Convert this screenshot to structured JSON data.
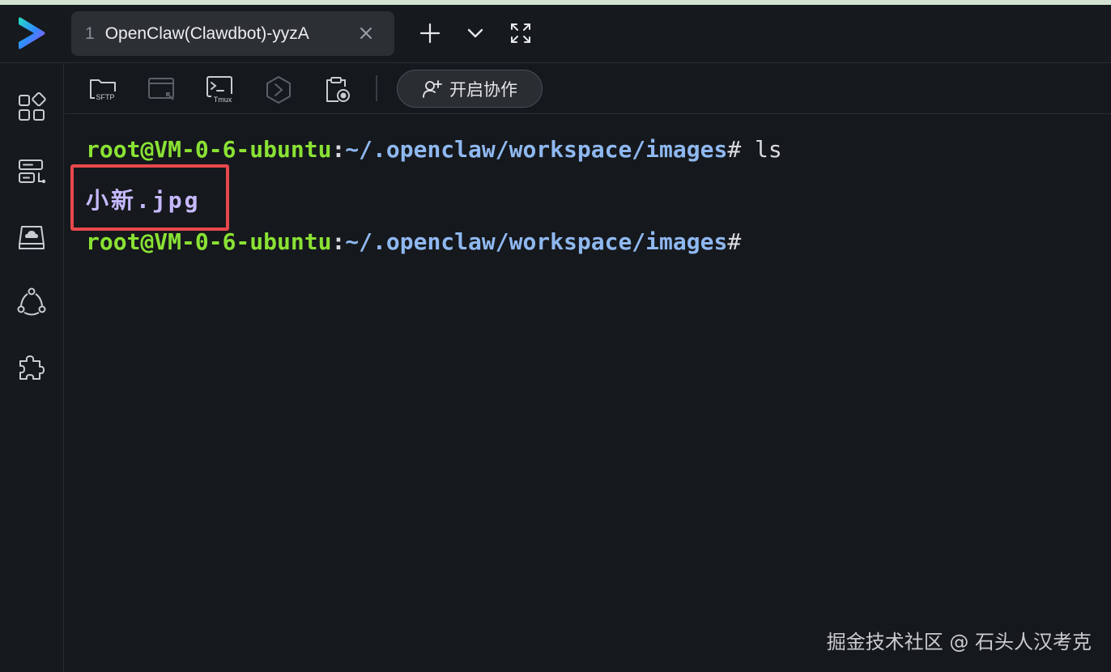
{
  "tab": {
    "number": "1",
    "title": "OpenClaw(Clawdbot)-yyzA"
  },
  "toolbar": {
    "sftp_label": "SFTP",
    "tmux_label": "Tmux",
    "collab_label": "开启协作"
  },
  "terminal": {
    "line1": {
      "user": "root@VM-0-6-ubuntu",
      "sep": ":",
      "path": "~/.openclaw/workspace/images",
      "prompt": "#",
      "command": " ls"
    },
    "line2": {
      "filename": "小新.jpg"
    },
    "line3": {
      "user": "root@VM-0-6-ubuntu",
      "sep": ":",
      "path": "~/.openclaw/workspace/images",
      "prompt": "#"
    }
  },
  "watermark": "掘金技术社区 @ 石头人汉考克",
  "colors": {
    "prompt_user": "#8ae234",
    "prompt_path": "#8fb8f0",
    "filename": "#c6b9ff",
    "highlight": "#e8484d"
  }
}
